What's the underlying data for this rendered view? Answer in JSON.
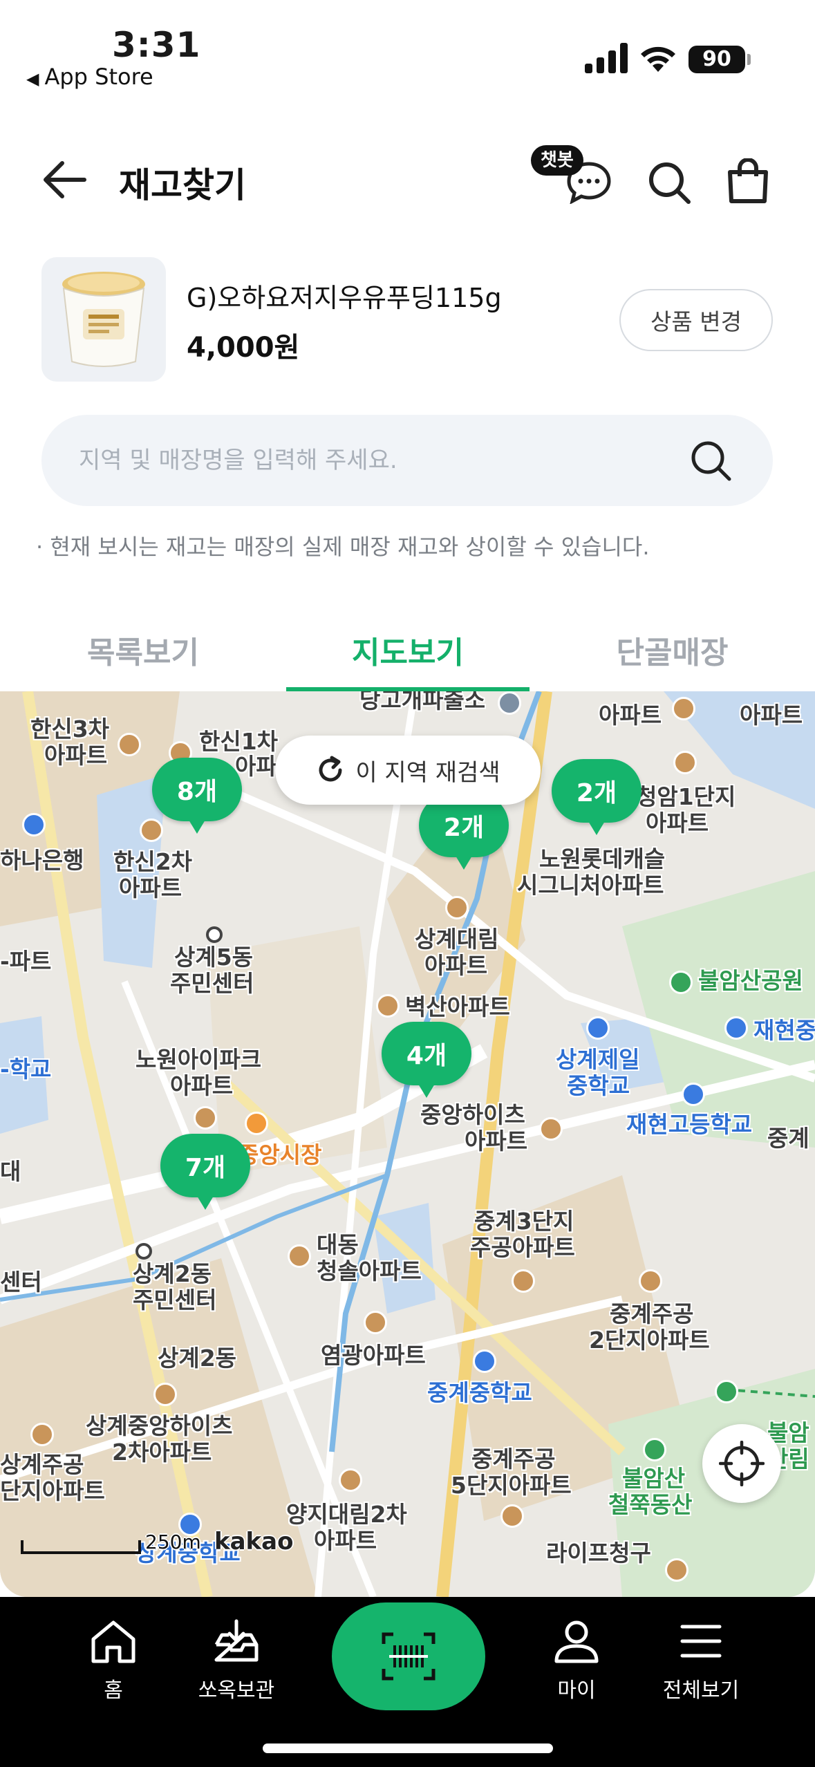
{
  "status_bar": {
    "time": "3:31",
    "back_app": "App Store",
    "battery": "90"
  },
  "header": {
    "title": "재고찾기",
    "chatbot_badge": "챗봇"
  },
  "product": {
    "name": "G)오하요저지우유푸딩115g",
    "price": "4,000원",
    "change_label": "상품 변경"
  },
  "store_search": {
    "placeholder": "지역 및 매장명을 입력해 주세요."
  },
  "notice": "· 현재 보시는 재고는 매장의 실제 매장 재고와 상이할 수 있습니다.",
  "tabs": [
    {
      "label": "목록보기",
      "active": false
    },
    {
      "label": "지도보기",
      "active": true
    },
    {
      "label": "단골매장",
      "active": false
    }
  ],
  "map": {
    "research_label": "이 지역 재검색",
    "clusters": [
      "8개",
      "2개",
      "2개",
      "4개",
      "7개"
    ],
    "places": [
      "당고개파출소",
      "아파트",
      "아파트",
      "한신3차",
      "아파트",
      "한신1차",
      "아파트",
      "청암1단지",
      "아파트",
      "하나은행",
      "한신2차",
      "아파트",
      "노원롯데캐슬",
      "시그니처아파트",
      "상계5동",
      "주민센터",
      "상계대림",
      "아파트",
      "불암산공원",
      "벽산아파트",
      "재현중",
      "-파트",
      "노원아이파크",
      "아파트",
      "상계제일",
      "중학교",
      "재현고등학교",
      "중계",
      "중앙하이츠",
      "아파트",
      "-학교",
      "중앙시장",
      "대",
      "중계3단지",
      "주공아파트",
      "센터",
      "상계2동",
      "주민센터",
      "대동",
      "청솔아파트",
      "중계주공",
      "2단지아파트",
      "상계2동",
      "염광아파트",
      "중계중학교",
      "상계중앙하이츠",
      "2차아파트",
      "상계주공",
      "단지아파트",
      "중계주공",
      "5단지아파트",
      "불암산",
      "철쭉동산",
      "불암",
      "산림",
      "양지대림2차",
      "아파트",
      "상계중학교",
      "라이프청구"
    ],
    "scale": "250m",
    "provider": "kakao"
  },
  "bottom_nav": {
    "items": [
      {
        "label": "홈",
        "icon": "home-icon"
      },
      {
        "label": "쏘옥보관",
        "icon": "storage-icon"
      },
      {
        "label": "",
        "icon": "barcode-scan-icon"
      },
      {
        "label": "마이",
        "icon": "person-icon"
      },
      {
        "label": "전체보기",
        "icon": "menu-icon"
      }
    ]
  },
  "colors": {
    "accent": "#15b46c",
    "tab_active": "#14b06a"
  }
}
